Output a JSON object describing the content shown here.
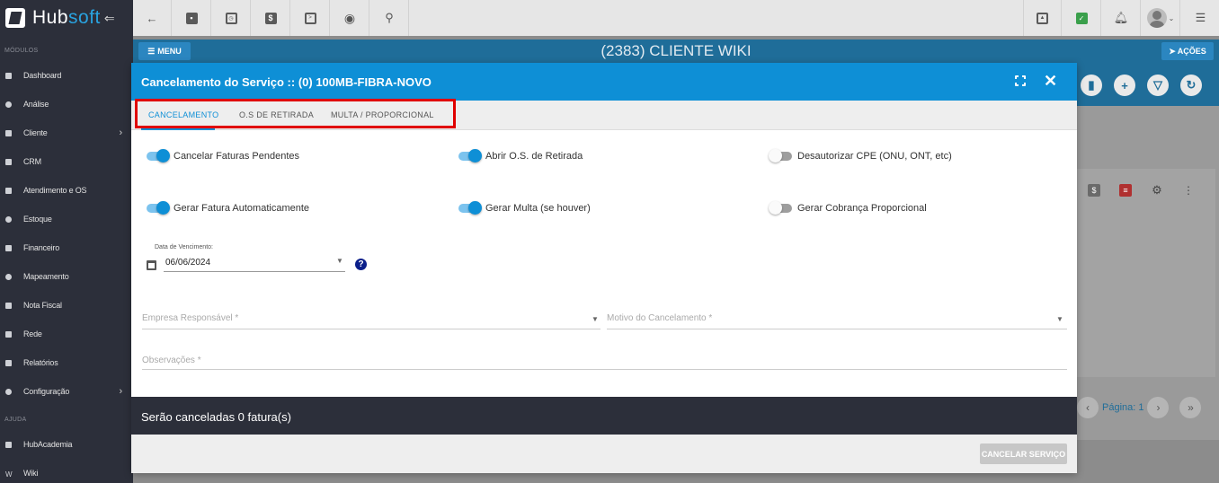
{
  "brand": {
    "name_part1": "Hub",
    "name_part2": "soft",
    "accent": "#29a3e0"
  },
  "sidebar": {
    "section_modules": "MÓDULOS",
    "items": [
      {
        "label": "Dashboard",
        "icon": "dashboard-icon"
      },
      {
        "label": "Análise",
        "icon": "chart-icon"
      },
      {
        "label": "Cliente",
        "icon": "client-icon",
        "has_submenu": true
      },
      {
        "label": "CRM",
        "icon": "crm-icon"
      },
      {
        "label": "Atendimento e OS",
        "icon": "calendar-icon"
      },
      {
        "label": "Estoque",
        "icon": "box-icon"
      },
      {
        "label": "Financeiro",
        "icon": "money-icon"
      },
      {
        "label": "Mapeamento",
        "icon": "map-icon"
      },
      {
        "label": "Nota Fiscal",
        "icon": "invoice-icon"
      },
      {
        "label": "Rede",
        "icon": "network-icon"
      },
      {
        "label": "Relatórios",
        "icon": "report-icon"
      },
      {
        "label": "Configuração",
        "icon": "gear-icon",
        "has_submenu": true
      }
    ],
    "section_help": "AJUDA",
    "help_items": [
      {
        "label": "HubAcademia",
        "icon": "video-icon"
      },
      {
        "label": "Wiki",
        "icon": "wiki-icon"
      }
    ]
  },
  "header": {
    "menu_label": "MENU",
    "client_title": "(2383) CLIENTE WIKI",
    "actions_label": "AÇÕES"
  },
  "page": {
    "pagination_label": "Página: 1"
  },
  "modal": {
    "title": "Cancelamento do Serviço :: (0) 100MB-FIBRA-NOVO",
    "tabs": [
      "CANCELAMENTO",
      "O.S DE RETIRADA",
      "MULTA / PROPORCIONAL"
    ],
    "active_tab": "CANCELAMENTO",
    "toggles": [
      {
        "label": "Cancelar Faturas Pendentes",
        "on": true
      },
      {
        "label": "Abrir O.S. de Retirada",
        "on": true
      },
      {
        "label": "Desautorizar CPE (ONU, ONT, etc)",
        "on": false
      },
      {
        "label": "Gerar Fatura Automaticamente",
        "on": true
      },
      {
        "label": "Gerar Multa (se houver)",
        "on": true
      },
      {
        "label": "Gerar Cobrança Proporcional",
        "on": false
      }
    ],
    "due_date_label": "Data de Vencimento:",
    "due_date_value": "06/06/2024",
    "company_placeholder": "Empresa Responsável *",
    "reason_placeholder": "Motivo do Cancelamento *",
    "notes_placeholder": "Observações *",
    "footer_text": "Serão canceladas 0 fatura(s)",
    "cancel_button": "CANCELAR SERVIÇO"
  },
  "colors": {
    "primary": "#0e8fd6",
    "sidebar_bg": "#2c2f3a",
    "highlight_box": "#e00000"
  }
}
